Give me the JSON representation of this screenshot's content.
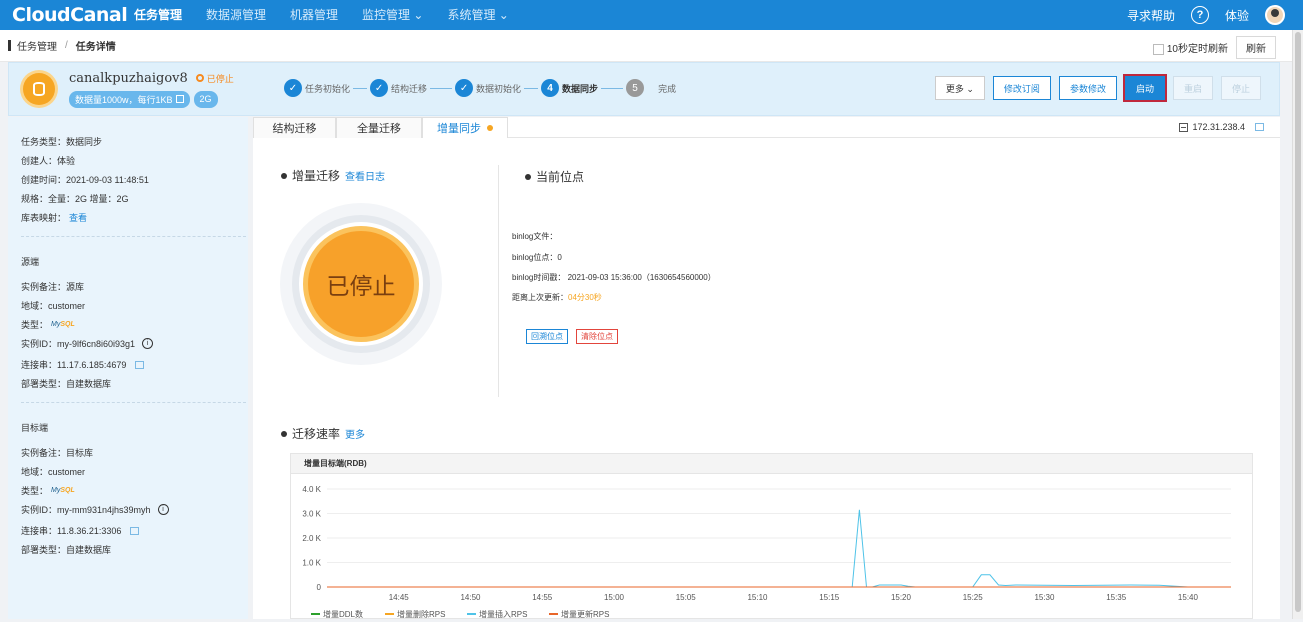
{
  "app": {
    "logo": "CloudCanal",
    "nav": [
      "任务管理",
      "数据源管理",
      "机器管理",
      "监控管理 ⌄",
      "系统管理 ⌄"
    ],
    "help": "寻求帮助",
    "help_icon": "?",
    "user": "体验"
  },
  "breadcrumb": {
    "parent": "任务管理",
    "separator": "/",
    "current": "任务详情",
    "auto_refresh": "10秒定时刷新",
    "refresh": "刷新"
  },
  "task": {
    "name": "canalkpuzhaigov8",
    "status": "已停止",
    "tag_data": "数据量1000w，每行1KB",
    "tag_size": "2G"
  },
  "steps": [
    {
      "num": "✓",
      "label": "任务初始化",
      "state": "done"
    },
    {
      "num": "✓",
      "label": "结构迁移",
      "state": "done"
    },
    {
      "num": "✓",
      "label": "数据初始化",
      "state": "done"
    },
    {
      "num": "4",
      "label": "数据同步",
      "state": "active"
    },
    {
      "num": "5",
      "label": "完成",
      "state": "todo"
    }
  ],
  "buttons": {
    "more": "更多 ⌄",
    "edit_sub": "修改订阅",
    "edit_params": "参数修改",
    "start": "启动",
    "restart": "重启",
    "stop": "停止"
  },
  "info": {
    "task_type": "任务类型：数据同步",
    "creator": "创建人：体验",
    "created": "创建时间：2021-09-03 11:48:51",
    "spec": "规格：全量：2G 增量：2G",
    "mapping_label": "库表映射：",
    "mapping_link": "查看",
    "source_title": "源端",
    "src_note": "实例备注：源库",
    "src_region": "地域：customer",
    "src_type": "类型：",
    "src_id": "实例ID：my-9lf6cn8i60i93g1",
    "src_conn": "连接串：11.17.6.185:4679",
    "src_deploy": "部署类型：自建数据库",
    "target_title": "目标端",
    "dst_note": "实例备注：目标库",
    "dst_region": "地域：customer",
    "dst_type": "类型：",
    "dst_id": "实例ID：my-mm931n4jhs39myh",
    "dst_conn": "连接串：11.8.36.21:3306",
    "dst_deploy": "部署类型：自建数据库",
    "info_icon": "i",
    "mysql_text": "My",
    "mysql_suffix": "SQL"
  },
  "tabs": {
    "structure": "结构迁移",
    "full": "全量迁移",
    "incremental": "增量同步"
  },
  "ip": "172.31.238.4",
  "incremental": {
    "title": "增量迁移",
    "log_link": "查看日志",
    "status": "已停止"
  },
  "position": {
    "title": "当前位点",
    "binlog_file": "binlog文件：",
    "binlog_pos": "binlog位点：0",
    "binlog_time": "binlog时间戳：  2021-09-03 15:36:00（1630654560000）",
    "last_update_label": "距离上次更新：",
    "last_update_value": "04分30秒",
    "rewind": "回溯位点",
    "clear": "清除位点"
  },
  "rate": {
    "title": "迁移速率",
    "more": "更多",
    "chart_title": "增量目标端(RDB)"
  },
  "colors": {
    "ddl": "#2ca02c",
    "delete": "#f6a623",
    "insert": "#4fc3e8",
    "update": "#e8662a"
  },
  "chart_data": {
    "type": "line",
    "title": "增量目标端(RDB)",
    "xlabel": "",
    "ylabel": "",
    "ylim": [
      0,
      4000
    ],
    "yticks": [
      0,
      1000,
      2000,
      3000,
      4000
    ],
    "ytick_labels": [
      "0",
      "1.0 K",
      "2.0 K",
      "3.0 K",
      "4.0 K"
    ],
    "xlim": [
      0,
      63
    ],
    "xticks": [
      5,
      10,
      15,
      20,
      25,
      30,
      35,
      40,
      45,
      50,
      55,
      60
    ],
    "xtick_labels": [
      "14:45",
      "14:50",
      "14:55",
      "15:00",
      "15:05",
      "15:10",
      "15:15",
      "15:20",
      "15:25",
      "15:30",
      "15:35",
      "15:40"
    ],
    "series": [
      {
        "name": "增量DDL数",
        "color": "#2ca02c",
        "x": [
          0,
          63
        ],
        "y": [
          0,
          0
        ]
      },
      {
        "name": "增量删除RPS",
        "color": "#f6a623",
        "x": [
          0,
          63
        ],
        "y": [
          0,
          0
        ]
      },
      {
        "name": "增量插入RPS",
        "color": "#4fc3e8",
        "x": [
          0,
          36,
          36.6,
          37.1,
          37.6,
          38,
          38.5,
          40,
          40.5,
          41,
          45,
          45.6,
          46.2,
          46.8,
          47.3,
          48,
          52,
          56,
          58,
          60,
          63
        ],
        "y": [
          0,
          0,
          0,
          3150,
          0,
          0,
          80,
          80,
          30,
          0,
          0,
          500,
          500,
          80,
          60,
          80,
          60,
          80,
          70,
          0,
          0
        ]
      },
      {
        "name": "增量更新RPS",
        "color": "#e8662a",
        "x": [
          0,
          63
        ],
        "y": [
          0,
          0
        ]
      }
    ]
  }
}
